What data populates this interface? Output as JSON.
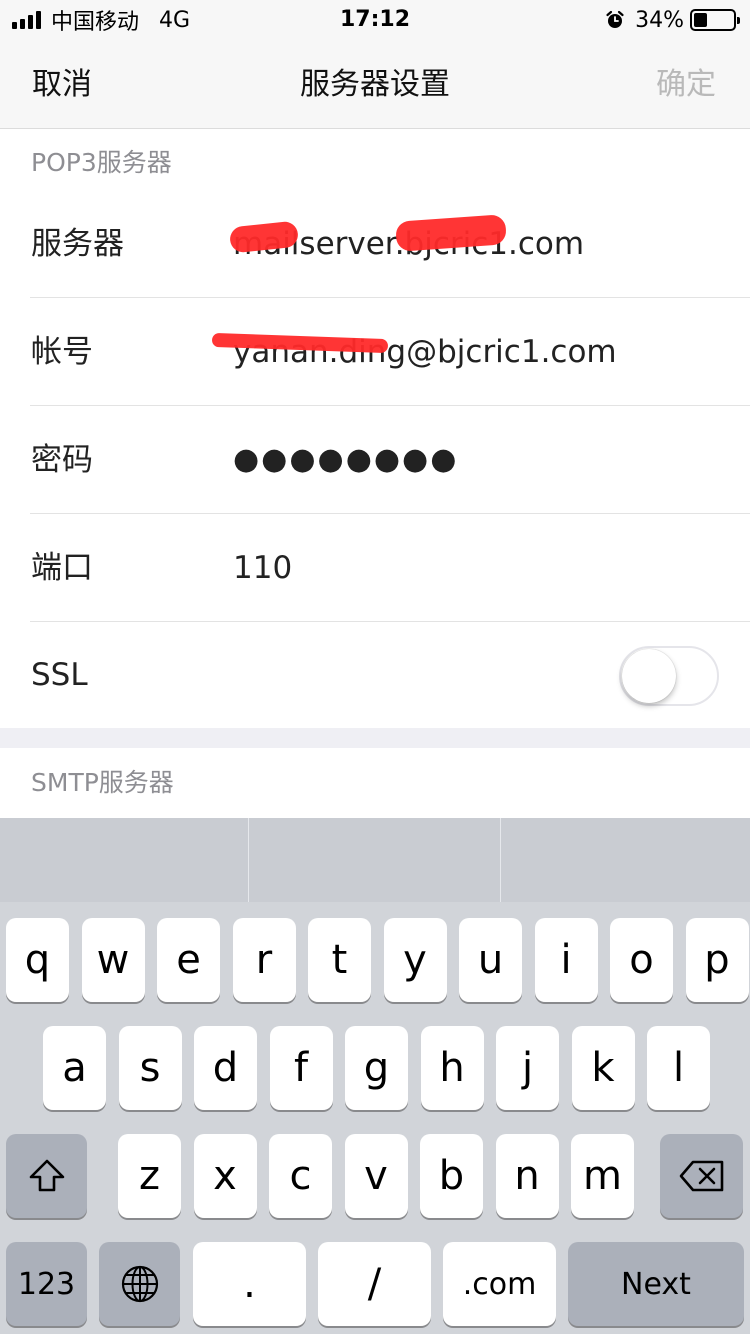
{
  "status_bar": {
    "carrier": "中国移动",
    "network": "4G",
    "time": "17:12",
    "battery_percent_label": "34%",
    "battery_level": 0.34,
    "signal_bars": 4,
    "alarm_icon": "alarm-clock-icon"
  },
  "nav": {
    "cancel_label": "取消",
    "title": "服务器设置",
    "confirm_label": "确定",
    "confirm_color": "#b9b9b9"
  },
  "pop3": {
    "header": "POP3服务器",
    "server": {
      "label": "服务器",
      "value": "mailserver.bjcric1.com"
    },
    "account": {
      "label": "帐号",
      "value": "yanan.ding@bjcric1.com"
    },
    "password": {
      "label": "密码",
      "value": "●●●●●●●●"
    },
    "port": {
      "label": "端口",
      "value": "110"
    },
    "ssl": {
      "label": "SSL",
      "enabled": false
    }
  },
  "smtp": {
    "header": "SMTP服务器"
  },
  "keyboard": {
    "row1": [
      "q",
      "w",
      "e",
      "r",
      "t",
      "y",
      "u",
      "i",
      "o",
      "p"
    ],
    "row2": [
      "a",
      "s",
      "d",
      "f",
      "g",
      "h",
      "j",
      "k",
      "l"
    ],
    "row3": [
      "z",
      "x",
      "c",
      "v",
      "b",
      "n",
      "m"
    ],
    "numbers_label": "123",
    "dot_label": ".",
    "slash_label": "/",
    "dotcom_label": ".com",
    "next_label": "Next",
    "shift_icon": "shift-arrow-icon",
    "globe_icon": "globe-icon",
    "delete_icon": "delete-backspace-icon"
  },
  "colors": {
    "redaction": "#ff2a2a",
    "keyboard_bg": "#d1d4d9",
    "toggle_off_border": "#e5e5ea"
  }
}
